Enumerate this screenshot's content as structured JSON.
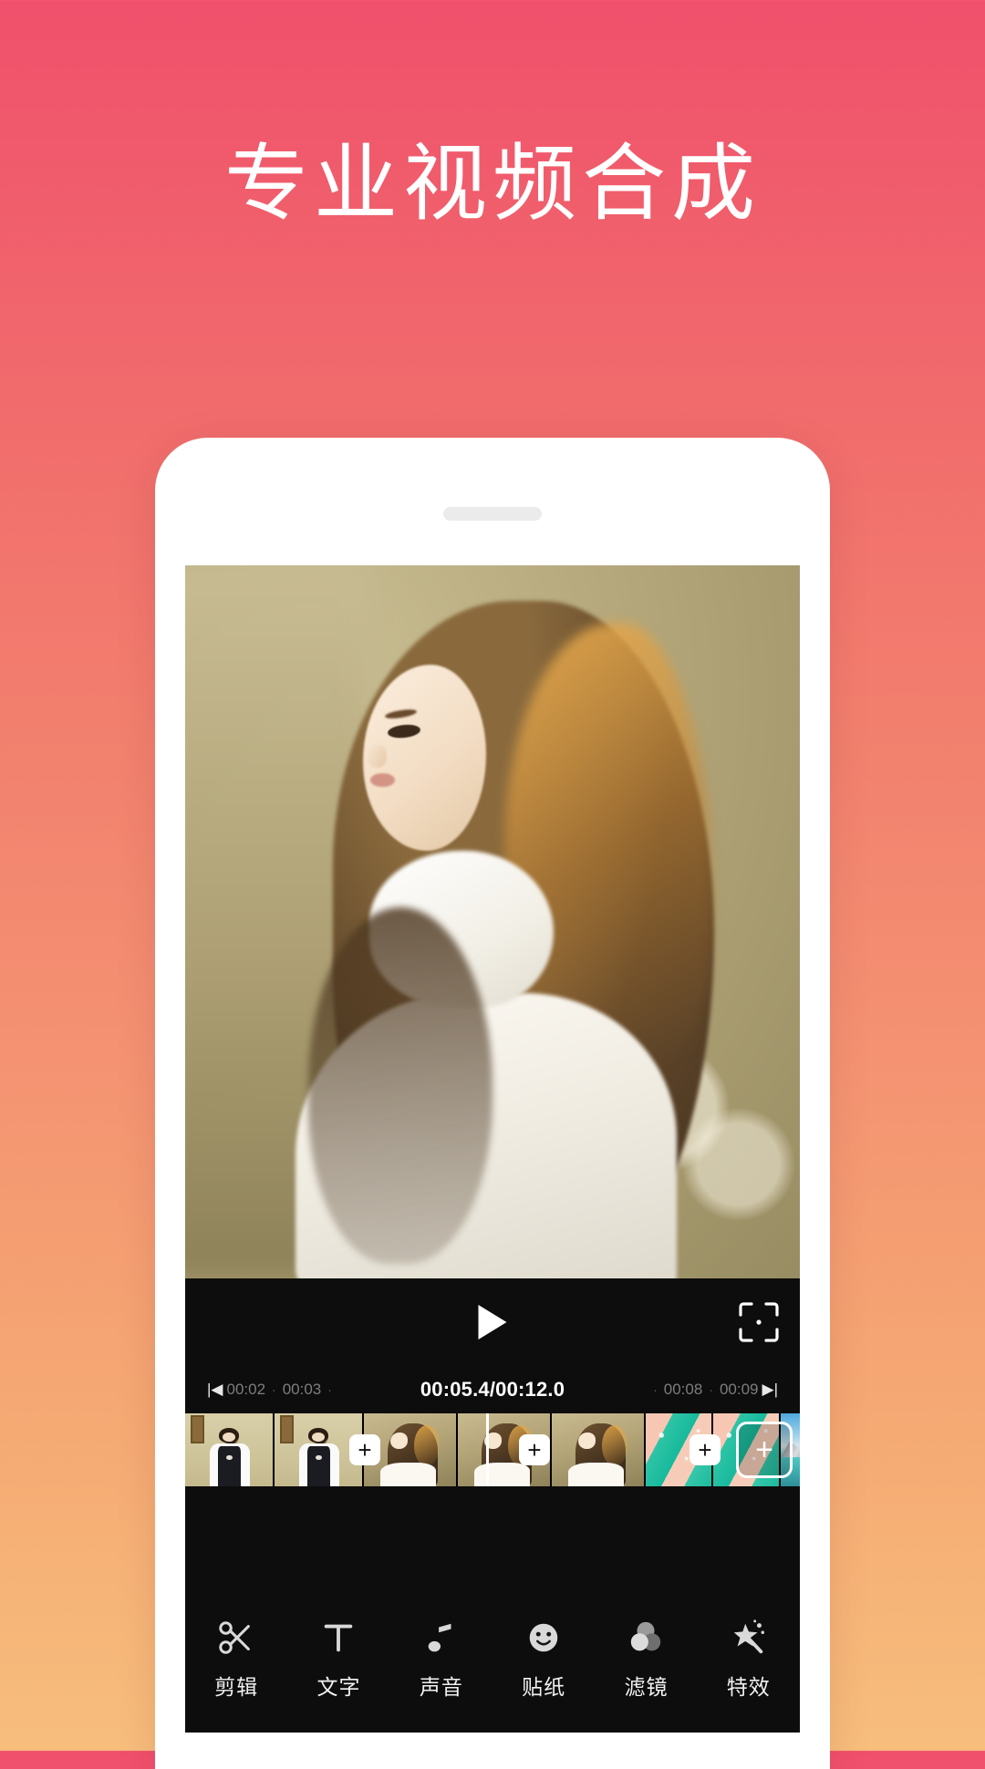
{
  "page": {
    "headline": "专业视频合成",
    "background_top": "#F0506C",
    "background_bottom": "#F7BE7C"
  },
  "player": {
    "play_label": "play-triangle",
    "crop_label": "crop-frame",
    "current_time": "00:05.4",
    "separator": "/",
    "total_time": "00:12.0",
    "current_over_total": "00:05.4/00:12.0",
    "skip_start": "|◀",
    "skip_end": "▶|",
    "ruler_left": [
      {
        "time": "00:02"
      },
      {
        "time": "00:03"
      }
    ],
    "ruler_right": [
      {
        "time": "00:08"
      },
      {
        "time": "00:09"
      }
    ],
    "tick_glyph": "·"
  },
  "timeline": {
    "add_small_label": "+",
    "add_big_label": "+",
    "clips": [
      {
        "name": "clip-indoor-girl-1"
      },
      {
        "name": "clip-indoor-girl-2"
      },
      {
        "name": "clip-outdoor-girl-1"
      },
      {
        "name": "clip-outdoor-girl-2"
      },
      {
        "name": "clip-outdoor-girl-3"
      },
      {
        "name": "clip-abstract-teal-1"
      },
      {
        "name": "clip-abstract-teal-2"
      },
      {
        "name": "clip-mountain-lake"
      }
    ]
  },
  "toolbar": {
    "items": [
      {
        "icon": "scissors-icon",
        "label": "剪辑"
      },
      {
        "icon": "text-t-icon",
        "label": "文字"
      },
      {
        "icon": "music-note-icon",
        "label": "声音"
      },
      {
        "icon": "smiley-icon",
        "label": "贴纸"
      },
      {
        "icon": "filter-circles-icon",
        "label": "滤镜"
      },
      {
        "icon": "magic-wand-icon",
        "label": "特效"
      }
    ]
  }
}
